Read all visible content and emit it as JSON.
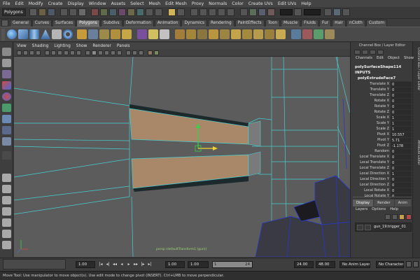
{
  "menubar": {
    "items": [
      "File",
      "Edit",
      "Modify",
      "Create",
      "Display",
      "Window",
      "Assets",
      "Select",
      "Mesh",
      "Edit Mesh",
      "Proxy",
      "Normals",
      "Color",
      "Create UVs",
      "Edit UVs",
      "Help"
    ]
  },
  "statusline": {
    "mode": "Polygons"
  },
  "shelf": {
    "tabs": [
      "General",
      "Curves",
      "Surfaces",
      "Polygons",
      "Subdivs",
      "Deformation",
      "Animation",
      "Dynamics",
      "Rendering",
      "PaintEffects",
      "Toon",
      "Muscle",
      "Fluids",
      "Fur",
      "Hair",
      "nCloth",
      "Custom"
    ],
    "active_tab": "Polygons"
  },
  "panel": {
    "menu": [
      "View",
      "Shading",
      "Lighting",
      "Show",
      "Renderer",
      "Panels"
    ],
    "camera_label": "persp (defaultTransform1 (gun))"
  },
  "channel_box": {
    "title": "Channel Box / Layer Editor",
    "menu": [
      "Channels",
      "Edit",
      "Object",
      "Show"
    ],
    "object_name": "polySurfaceShape114",
    "inputs_label": "INPUTS",
    "node_name": "polyExtrudeFace7",
    "attributes": [
      {
        "name": "Translate X",
        "value": "0"
      },
      {
        "name": "Translate Y",
        "value": "0"
      },
      {
        "name": "Translate Z",
        "value": "0"
      },
      {
        "name": "Rotate X",
        "value": "0"
      },
      {
        "name": "Rotate Y",
        "value": "0"
      },
      {
        "name": "Rotate Z",
        "value": "0"
      },
      {
        "name": "Scale X",
        "value": "1"
      },
      {
        "name": "Scale Y",
        "value": "1"
      },
      {
        "name": "Scale Z",
        "value": "1"
      },
      {
        "name": "Pivot X",
        "value": "10.557"
      },
      {
        "name": "Pivot Y",
        "value": "5.71"
      },
      {
        "name": "Pivot Z",
        "value": "-1.178"
      },
      {
        "name": "Random",
        "value": "0"
      },
      {
        "name": "Local Translate X",
        "value": "0"
      },
      {
        "name": "Local Translate Y",
        "value": "0"
      },
      {
        "name": "Local Translate Z",
        "value": "0"
      },
      {
        "name": "Local Direction X",
        "value": "1"
      },
      {
        "name": "Local Direction Y",
        "value": "0"
      },
      {
        "name": "Local Direction Z",
        "value": "0"
      },
      {
        "name": "Local Rotate X",
        "value": "0"
      },
      {
        "name": "Local Rotate Y",
        "value": "0"
      }
    ],
    "side_tabs": [
      "Channel Box / Layer Editor",
      "Attribute Editor"
    ]
  },
  "layer_editor": {
    "tabs": [
      "Display",
      "Render",
      "Anim"
    ],
    "active_tab": "Display",
    "menu": [
      "Layers",
      "Options",
      "Help"
    ],
    "layer_name": "gun_19:trigger_01",
    "visible_flag": "V"
  },
  "time_slider": {
    "current_time": "1.00",
    "start_time": "1.00",
    "playback_start": "1.00",
    "range_start": "1",
    "range_end": "24",
    "playback_end": "24.00",
    "end_time": "48.00",
    "anim_layer": "No Anim Layer",
    "character_set": "No Character Set",
    "playback_buttons": [
      "|◂",
      "◂|",
      "◂◂",
      "◂",
      "▸",
      "▸▸",
      "|▸",
      "▸|"
    ]
  },
  "helpline": {
    "text": "Move Tool: Use manipulator to move object(s). Use edit mode to change pivot (INSERT). Ctrl+LMB to move perpendicular."
  },
  "colors": {
    "viewport_bg": "#5c5c5c",
    "wire_cyan": "#49cfd2",
    "face_selected": "#a88868",
    "gizmo_green": "#38d24a",
    "gizmo_yellow": "#f2d52a",
    "mesh_dark": "#3a3a44",
    "mesh_wire_blue": "#2838c8"
  }
}
